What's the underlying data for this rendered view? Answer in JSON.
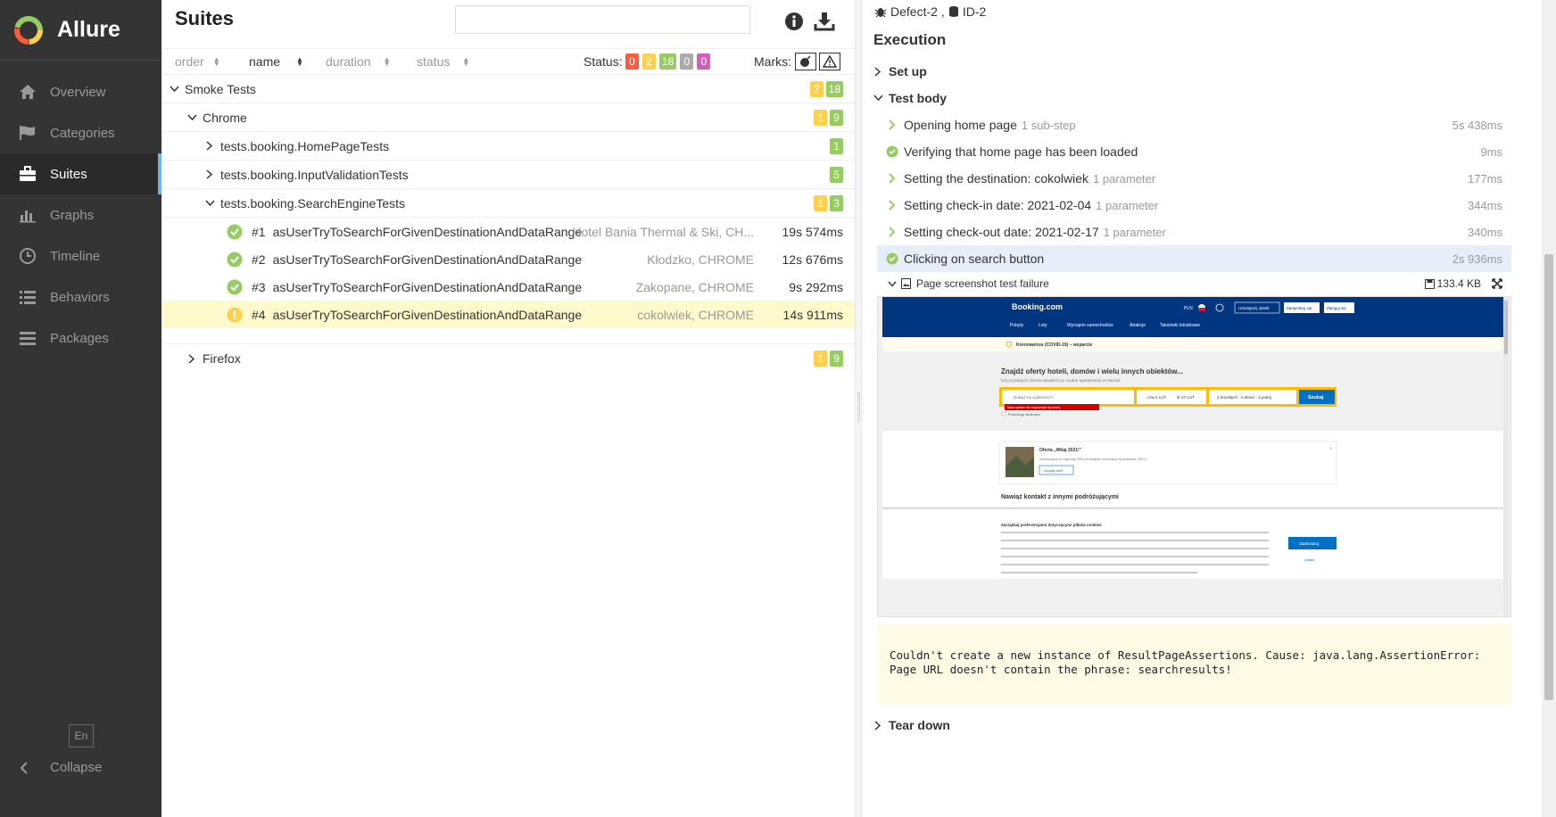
{
  "app": {
    "name": "Allure",
    "lang": "En",
    "collapse": "Collapse"
  },
  "sidebar": {
    "items": [
      {
        "label": "Overview",
        "icon": "home-icon"
      },
      {
        "label": "Categories",
        "icon": "flag-icon"
      },
      {
        "label": "Suites",
        "icon": "briefcase-icon",
        "active": true
      },
      {
        "label": "Graphs",
        "icon": "bar-chart-icon"
      },
      {
        "label": "Timeline",
        "icon": "clock-icon"
      },
      {
        "label": "Behaviors",
        "icon": "list-icon"
      },
      {
        "label": "Packages",
        "icon": "packages-icon"
      }
    ]
  },
  "suites": {
    "title": "Suites",
    "search_value": "",
    "sort": {
      "order": "order",
      "name": "name",
      "duration": "duration",
      "status": "status"
    },
    "status_label": "Status:",
    "status_counts": [
      "0",
      "2",
      "18",
      "0",
      "0"
    ],
    "marks_label": "Marks:",
    "tree": {
      "smoke": {
        "label": "Smoke Tests",
        "badges": [
          "2",
          "18"
        ]
      },
      "chrome": {
        "label": "Chrome",
        "badges": [
          "1",
          "9"
        ]
      },
      "home": {
        "label": "tests.booking.HomePageTests",
        "badges": [
          "1"
        ]
      },
      "input": {
        "label": "tests.booking.InputValidationTests",
        "badges": [
          "5"
        ]
      },
      "search": {
        "label": "tests.booking.SearchEngineTests",
        "badges": [
          "1",
          "3"
        ]
      },
      "tests": [
        {
          "num": "#1",
          "name": "asUserTryToSearchForGivenDestinationAndDataRange",
          "info": "Hotel Bania Thermal & Ski, CH...",
          "dur": "19s 574ms",
          "status": "passed"
        },
        {
          "num": "#2",
          "name": "asUserTryToSearchForGivenDestinationAndDataRange",
          "info": "Kłodzko, CHROME",
          "dur": "12s 676ms",
          "status": "passed"
        },
        {
          "num": "#3",
          "name": "asUserTryToSearchForGivenDestinationAndDataRange",
          "info": "Zakopane, CHROME",
          "dur": "9s 292ms",
          "status": "passed"
        },
        {
          "num": "#4",
          "name": "asUserTryToSearchForGivenDestinationAndDataRange",
          "info": "cokolwiek, CHROME",
          "dur": "14s 911ms",
          "status": "broken"
        }
      ],
      "firefox": {
        "label": "Firefox",
        "badges": [
          "1",
          "9"
        ]
      }
    }
  },
  "detail": {
    "links": {
      "defect": "Defect-2",
      "sep": ",",
      "id": "ID-2"
    },
    "execution": "Execution",
    "setup": "Set up",
    "body": "Test body",
    "steps": [
      {
        "name": "Opening home page",
        "sub": "1 sub-step",
        "dur": "5s 438ms",
        "kind": "expand"
      },
      {
        "name": "Verifying that home page has been loaded",
        "sub": "",
        "dur": "9ms",
        "kind": "check"
      },
      {
        "name": "Setting the destination: cokolwiek",
        "sub": "1 parameter",
        "dur": "177ms",
        "kind": "expand"
      },
      {
        "name": "Setting check-in date: 2021-02-04",
        "sub": "1 parameter",
        "dur": "344ms",
        "kind": "expand"
      },
      {
        "name": "Setting check-out date: 2021-02-17",
        "sub": "1 parameter",
        "dur": "340ms",
        "kind": "expand"
      },
      {
        "name": "Clicking on search button",
        "sub": "",
        "dur": "2s 936ms",
        "kind": "check"
      }
    ],
    "attachment": {
      "name": "Page screenshot test failure",
      "size": "133.4 KB"
    },
    "screenshot": {
      "brand": "Booking.com",
      "currency": "PLN",
      "nav": [
        "Pobyty",
        "Loty",
        "Wynajem samochodów",
        "Atrakcje",
        "Taksówki lotniskowe"
      ],
      "btns": [
        "Udostępnij obiekt",
        "Zarejestruj się",
        "Zaloguj się"
      ],
      "covid": "Koronawirus (COVID-19) – wsparcie",
      "headline": "Znajdź oferty hoteli, domów i wielu innych obiektów...",
      "sub": "Od przytulnych domów wiejskich po modne apartamenty w mieście",
      "dest_placeholder": "Dokąd się wybierasz?",
      "checkin": "czw 4 LUT",
      "checkout": "śr 17 LUT",
      "guests": "2 dorosłych · 0 dzieci · 1 pokój",
      "search": "Szukaj",
      "error": "Nasz system nie rozpoznaje tej nazwy",
      "business": "Podróżuję służbowo",
      "offer_title": "Oferta „Witaj 2021!\"",
      "offer_text": "Zaoszczędź co najmniej 20% na kolejnej rezerwacji na powitanie 2021 r.",
      "offer_btn": "Szukaj ofert",
      "contact": "Nawiąż kontakt z innymi podróżującymi",
      "cookie_title": "Zarządzaj preferencjami dotyczącymi plików cookies",
      "cookie_btn": "Zaakceptuj",
      "cookie_link": "Ustaw"
    },
    "error": "Couldn't create a new instance of ResultPageAssertions. Cause: java.lang.AssertionError:\nPage URL doesn't contain the phrase: searchresults!",
    "teardown": "Tear down"
  },
  "colors": {
    "sidebar": "#343434",
    "failed": "#fd5a3e",
    "broken": "#ffd050",
    "passed": "#97cc64",
    "skipped": "#aaaaaa",
    "unknown": "#d35ebe",
    "accent": "#6eb4e6"
  }
}
